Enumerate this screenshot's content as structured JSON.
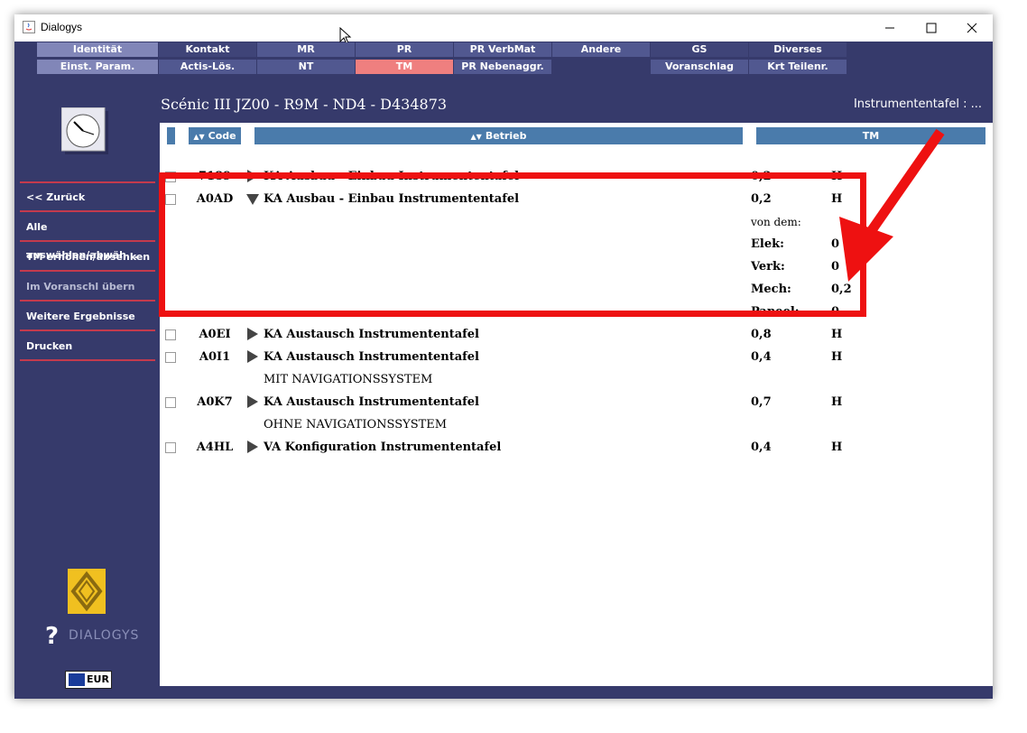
{
  "window": {
    "title": "Dialogys"
  },
  "tabs": {
    "row1": [
      "Identität",
      "Kontakt",
      "MR",
      "PR",
      "PR VerbMat",
      "Andere",
      "GS",
      "Diverses"
    ],
    "row2": [
      "Einst. Param.",
      "Actis-Lös.",
      "NT",
      "TM",
      "PR Nebenaggr.",
      "",
      "Voranschlag",
      "Krt Teilenr."
    ],
    "active": "TM"
  },
  "header": {
    "vehicle": "Scénic III JZ00 - R9M - ND4 - D434873",
    "section": "Instrumententafel : ..."
  },
  "sidebar": {
    "buttons": [
      "<< Zurück",
      "Alle auswählen/abwäh...",
      "TM erhöhen/absenken",
      "Im Voranschl übern",
      "Weitere Ergebnisse",
      "Drucken"
    ],
    "brand": "DIALOGYS",
    "currency": "EUR"
  },
  "columns": {
    "code": "Code",
    "betrieb": "Betrieb",
    "tm": "TM"
  },
  "rows": [
    {
      "code": "7189",
      "desc": "KA Ausbau - Einbau Instrumententafel",
      "value": "0,2",
      "unit": "H"
    },
    {
      "code": "A0AD",
      "desc": "KA Ausbau - Einbau Instrumententafel",
      "value": "0,2",
      "unit": "H",
      "expanded": {
        "label": "von dem:",
        "items": [
          {
            "label": "Elek:",
            "value": "0"
          },
          {
            "label": "Verk:",
            "value": "0"
          },
          {
            "label": "Mech:",
            "value": "0,2"
          },
          {
            "label": "Paneel:",
            "value": "0"
          }
        ]
      }
    },
    {
      "code": "A0EI",
      "desc": "KA Austausch Instrumententafel",
      "value": "0,8",
      "unit": "H"
    },
    {
      "code": "A0I1",
      "desc": "KA Austausch Instrumententafel",
      "value": "0,4",
      "unit": "H",
      "note": "MIT NAVIGATIONSSYSTEM"
    },
    {
      "code": "A0K7",
      "desc": "KA Austausch Instrumententafel",
      "value": "0,7",
      "unit": "H",
      "note": "OHNE NAVIGATIONSSYSTEM"
    },
    {
      "code": "A4HL",
      "desc": "VA Konfiguration Instrumententafel",
      "value": "0,4",
      "unit": "H"
    }
  ],
  "colors": {
    "window_bg": "#363a6b",
    "header_blue": "#4a7bab",
    "active_tab": "#ef7f7f",
    "highlight": "#ee1111"
  }
}
